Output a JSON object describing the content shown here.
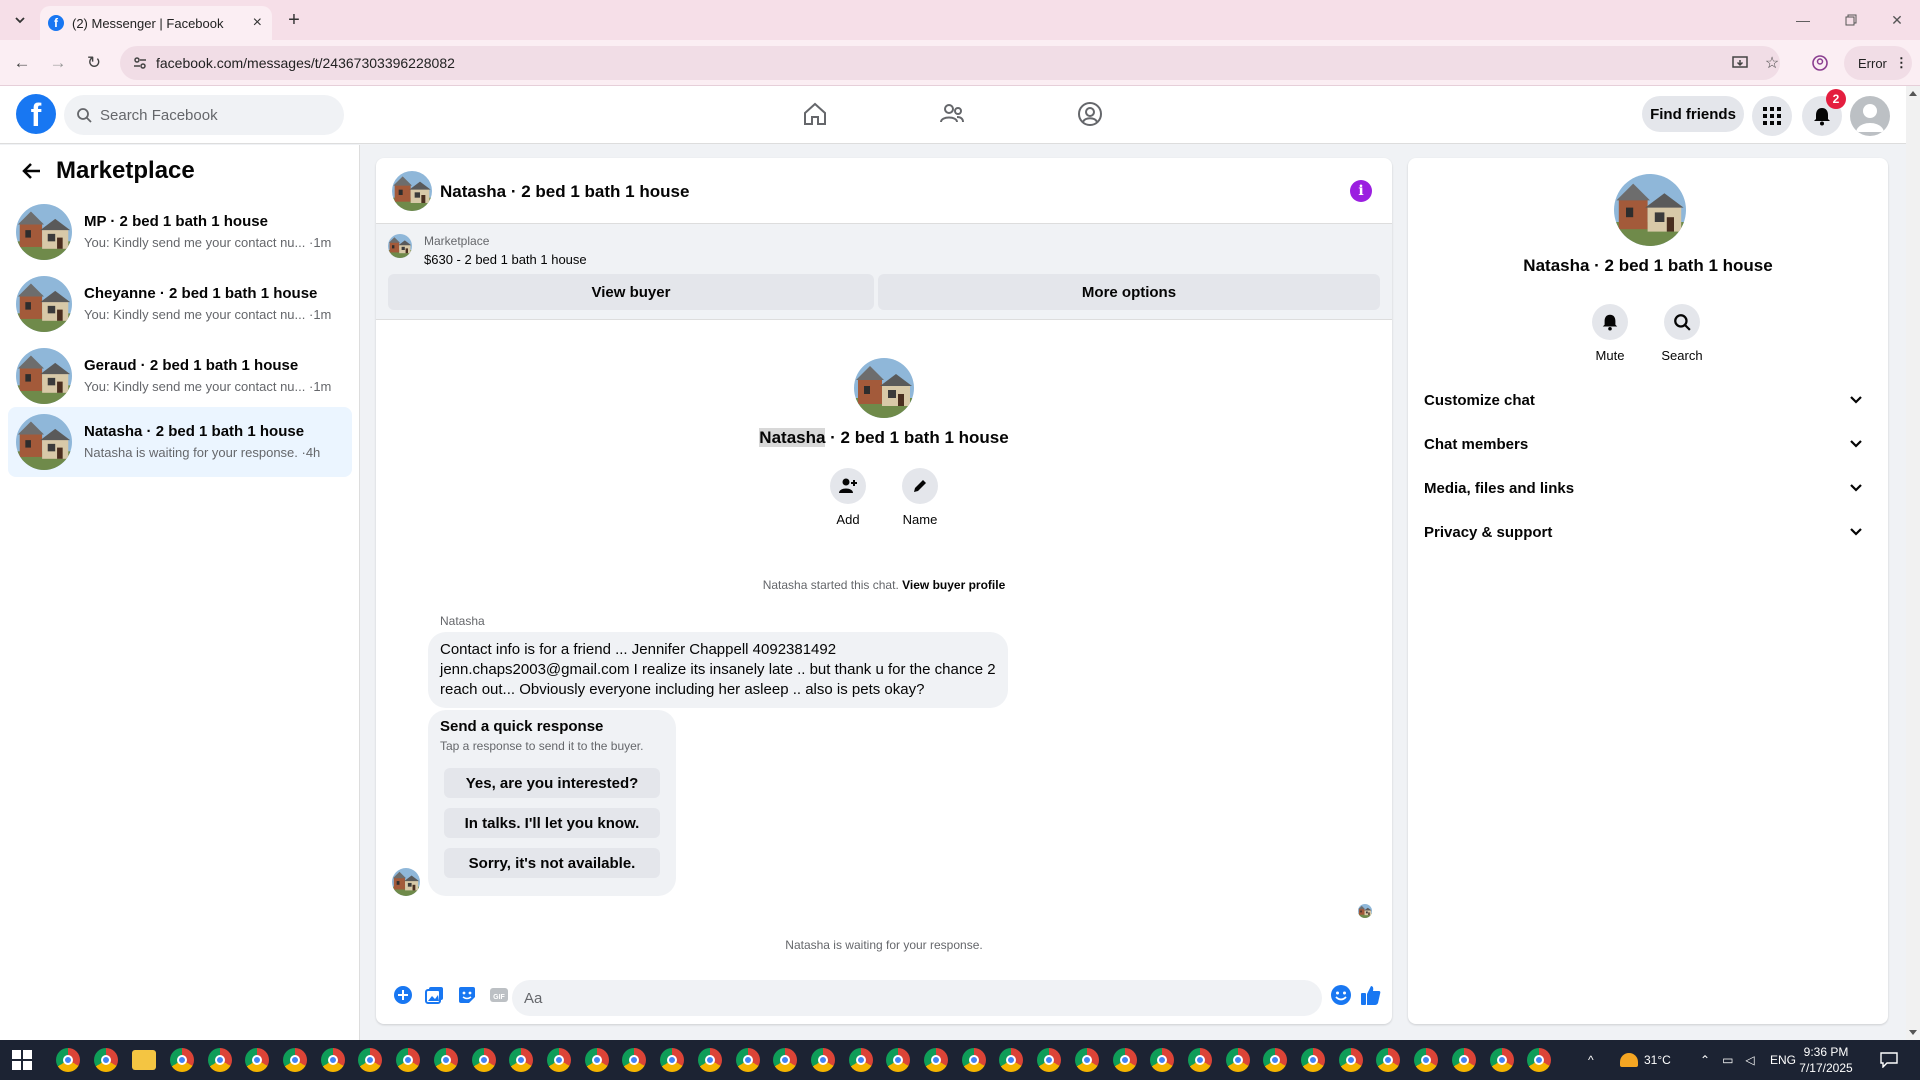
{
  "browser": {
    "tab_title": "(2) Messenger | Facebook",
    "url": "facebook.com/messages/t/24367303396228082",
    "profile_status": "Error"
  },
  "header": {
    "search_placeholder": "Search Facebook",
    "find_friends": "Find friends",
    "notification_count": "2"
  },
  "sidebar": {
    "title": "Marketplace",
    "conversations": [
      {
        "name": "MP · 2 bed 1 bath 1 house",
        "snippet": "You: Kindly send me your contact nu... ·1m"
      },
      {
        "name": "Cheyanne · 2 bed 1 bath 1 house",
        "snippet": "You: Kindly send me your contact nu... ·1m"
      },
      {
        "name": "Geraud · 2 bed 1 bath 1 house",
        "snippet": "You: Kindly send me your contact nu... ·1m"
      },
      {
        "name": "Natasha · 2 bed 1 bath 1 house",
        "snippet": "Natasha is waiting for your response. ·4h"
      }
    ]
  },
  "chat": {
    "title": "Natasha · 2 bed 1 bath 1 house",
    "marketplace_label": "Marketplace",
    "listing": "$630 - 2 bed 1 bath 1 house",
    "view_buyer": "View buyer",
    "more_options": "More options",
    "intro_name": "Natasha",
    "intro_rest": " · 2 bed 1 bath 1 house",
    "add_label": "Add",
    "name_label": "Name",
    "started_text": "Natasha started this chat.",
    "view_profile": "View buyer profile",
    "sender": "Natasha",
    "message": "Contact info is for a friend ... Jennifer Chappell 4092381492 jenn.chaps2003@gmail.com I realize its insanely late .. but thank u for the chance 2 reach out... Obviously everyone including her asleep .. also is pets okay?",
    "quick_title": "Send a quick response",
    "quick_sub": "Tap a response to send it to the buyer.",
    "quick_responses": [
      "Yes, are you interested?",
      "In talks. I'll let you know.",
      "Sorry, it's not available."
    ],
    "waiting": "Natasha is waiting for your response.",
    "input_placeholder": "Aa"
  },
  "details": {
    "title": "Natasha · 2 bed 1 bath 1 house",
    "mute": "Mute",
    "search": "Search",
    "sections": [
      "Customize chat",
      "Chat members",
      "Media, files and links",
      "Privacy & support"
    ]
  },
  "taskbar": {
    "temperature": "31°C",
    "language": "ENG",
    "time": "9:36 PM",
    "date": "7/17/2025"
  },
  "colors": {
    "fb_blue": "#1877f2",
    "info_purple": "#9b1fe0",
    "badge_red": "#e41e3f",
    "active_conv": "#ebf5ff"
  }
}
